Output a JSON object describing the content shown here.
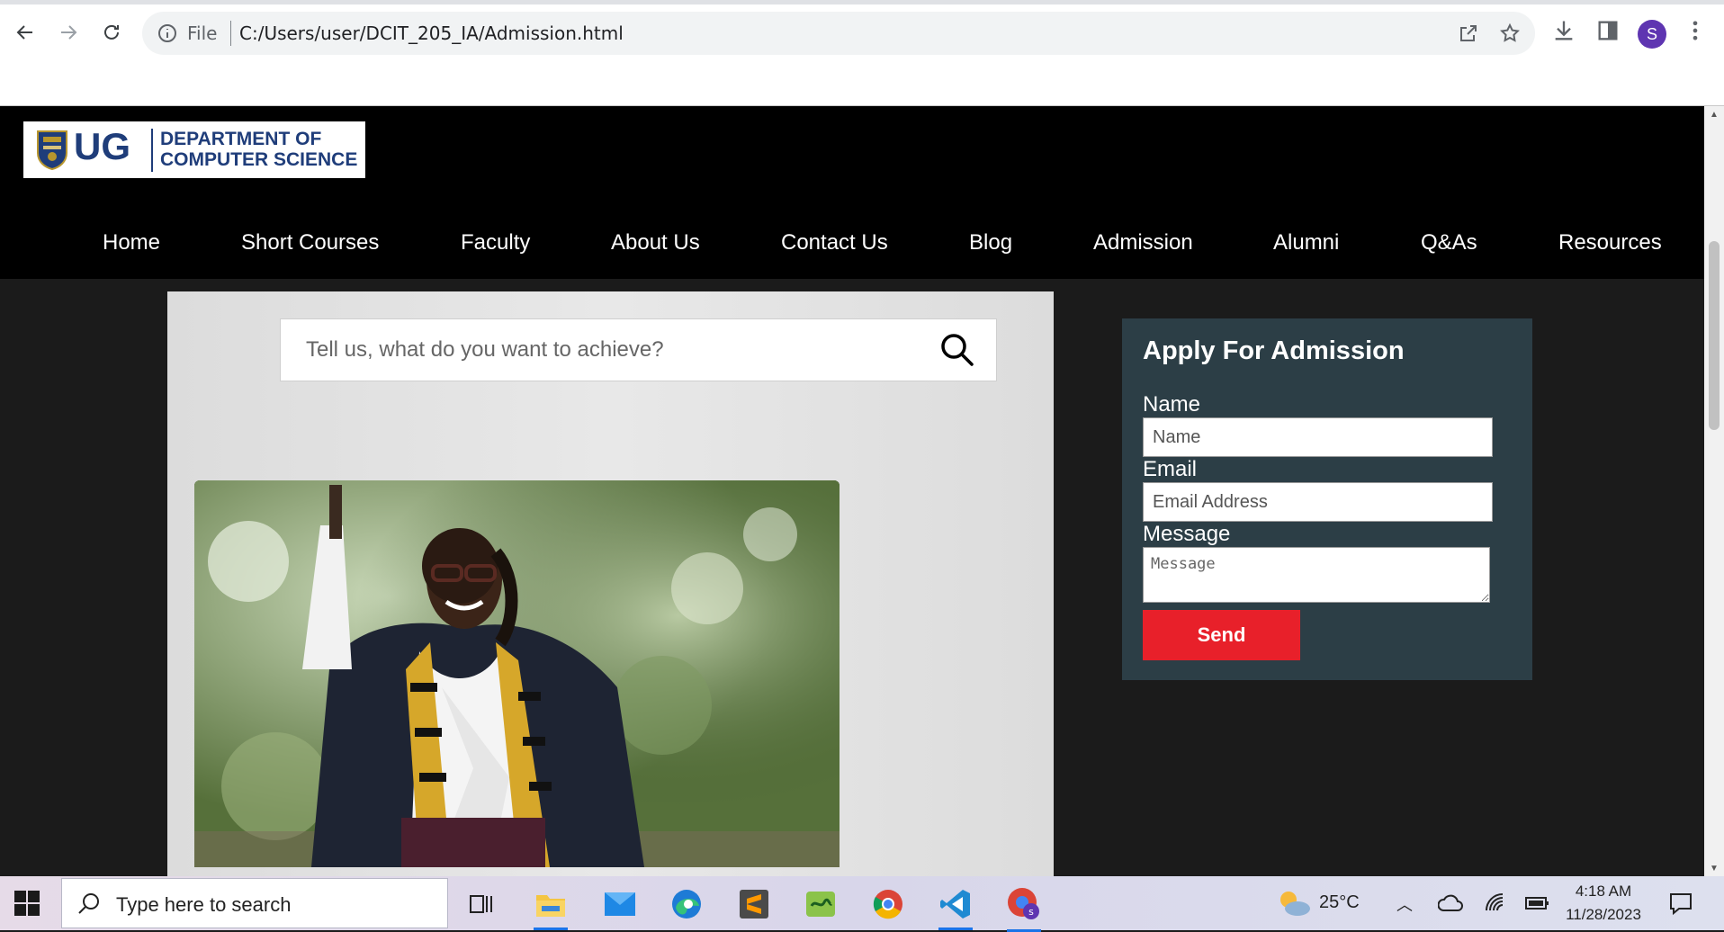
{
  "browser": {
    "file_label": "File",
    "url": "C:/Users/user/DCIT_205_IA/Admission.html",
    "profile_initial": "S"
  },
  "site": {
    "logo": {
      "ug": "UG",
      "line1": "DEPARTMENT OF",
      "line2": "COMPUTER SCIENCE"
    },
    "nav": [
      {
        "label": "Home"
      },
      {
        "label": "Short Courses"
      },
      {
        "label": "Faculty"
      },
      {
        "label": "About Us"
      },
      {
        "label": "Contact Us"
      },
      {
        "label": "Blog"
      },
      {
        "label": "Admission"
      },
      {
        "label": "Alumni"
      },
      {
        "label": "Q&As"
      },
      {
        "label": "Resources"
      }
    ],
    "search": {
      "placeholder": "Tell us, what do you want to achieve?"
    },
    "admission_form": {
      "title": "Apply For Admission",
      "name_label": "Name",
      "name_placeholder": "Name",
      "email_label": "Email",
      "email_placeholder": "Email Address",
      "message_label": "Message",
      "message_placeholder": "Message",
      "send_label": "Send"
    }
  },
  "taskbar": {
    "search_placeholder": "Type here to search",
    "weather": "25°C",
    "time": "4:18 AM",
    "date": "11/28/2023"
  },
  "colors": {
    "header_bg": "#000000",
    "page_bg": "#1b1b1b",
    "form_bg": "#2c3e46",
    "send_button": "#e8202a",
    "logo_blue": "#1f3d7a"
  }
}
